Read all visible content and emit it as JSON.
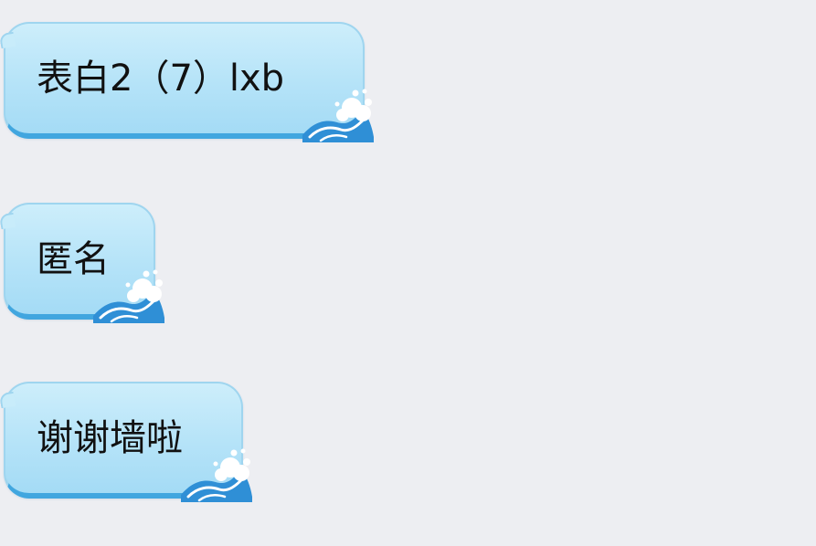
{
  "messages": [
    {
      "text": "表白2（7）lxb"
    },
    {
      "text": "匿名"
    },
    {
      "text": "谢谢墙啦"
    }
  ],
  "colors": {
    "background": "#edeef2",
    "bubble_top": "#cdeefb",
    "bubble_bottom": "#a4dbf5",
    "bubble_edge": "#41a6df",
    "text": "#111111"
  },
  "icons": {
    "bubble_decoration": "wave-icon"
  }
}
